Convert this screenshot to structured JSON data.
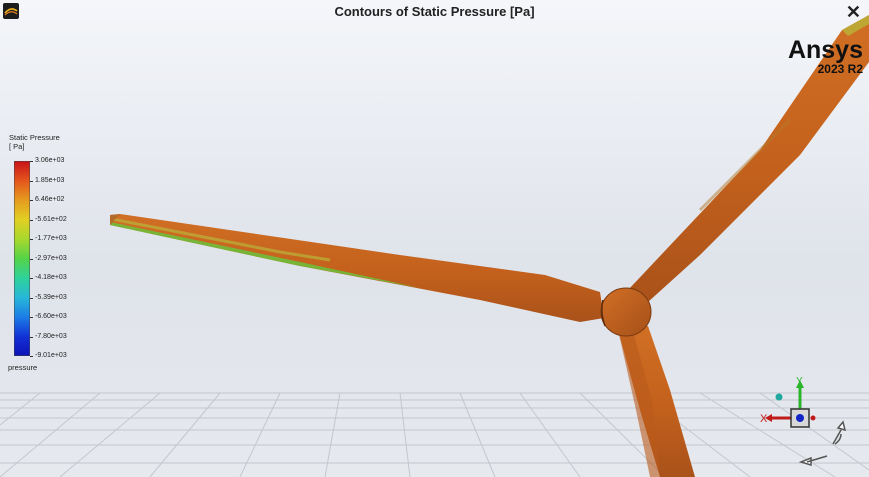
{
  "window": {
    "title": "Contours of Static Pressure [Pa]",
    "close_label": "✕"
  },
  "brand": {
    "name": "Ansys",
    "version": "2023 R2"
  },
  "legend": {
    "title_line1": "Static Pressure",
    "title_line2": "[ Pa]",
    "variable": "pressure",
    "ticks": [
      "3.06e+03",
      "1.85e+03",
      "6.46e+02",
      "-5.61e+02",
      "-1.77e+03",
      "-2.97e+03",
      "-4.18e+03",
      "-5.39e+03",
      "-6.60e+03",
      "-7.80e+03",
      "-9.01e+03"
    ],
    "colors": [
      "#c8121a",
      "#e4551c",
      "#e59b1f",
      "#e2cf24",
      "#a9d82c",
      "#55d348",
      "#2ed29a",
      "#27b7d8",
      "#1c7ee6",
      "#1231d6",
      "#0d12b5"
    ]
  },
  "scene": {
    "blade_color": "#c9641e",
    "floor_grid_color": "#b8bcc3"
  },
  "triad": {
    "x_label": "X",
    "y_label": "Y"
  }
}
